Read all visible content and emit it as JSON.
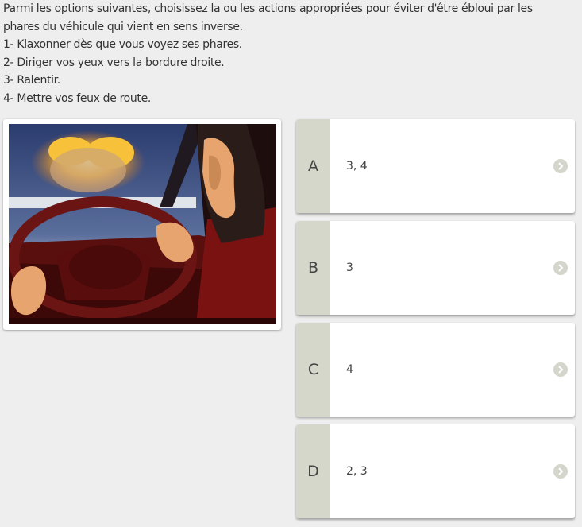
{
  "question": {
    "lines": [
      "Parmi les options suivantes, choisissez la ou les actions appropriées pour éviter d'être ébloui par les",
      "phares du véhicule qui vient en sens inverse.",
      "1- Klaxonner dès que vous voyez ses phares.",
      "2- Diriger vos yeux vers la bordure droite.",
      "3- Ralentir.",
      "4- Mettre vos feux de route."
    ]
  },
  "answers": [
    {
      "letter": "A",
      "text": "3, 4"
    },
    {
      "letter": "B",
      "text": "3"
    },
    {
      "letter": "C",
      "text": "4"
    },
    {
      "letter": "D",
      "text": "2, 3"
    }
  ],
  "colors": {
    "letter_box": "#d4d7ca",
    "chevron_bg": "#d4d6cc",
    "background": "#eeeeee"
  },
  "icons": {
    "chevron": "chevron-right-icon"
  }
}
